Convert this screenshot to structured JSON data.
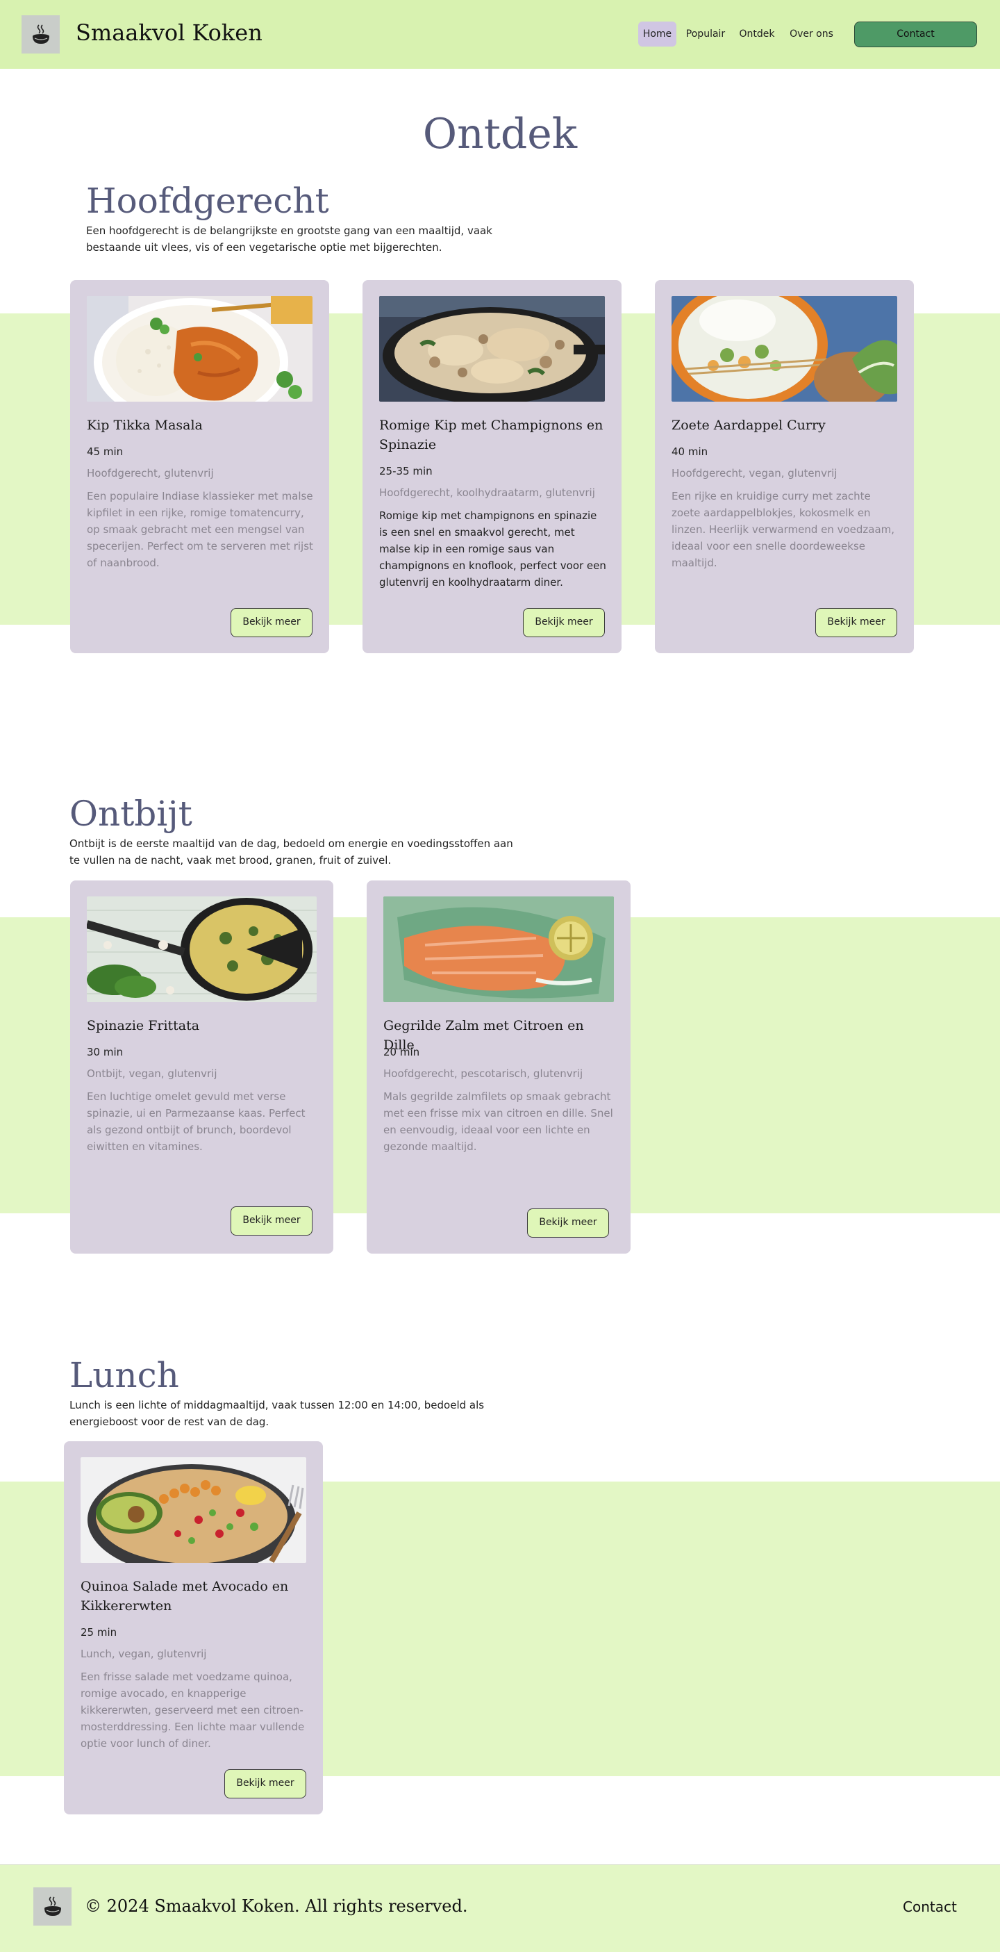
{
  "header": {
    "brand": "Smaakvol Koken",
    "nav": [
      "Home",
      "Populair",
      "Ontdek",
      "Over ons"
    ],
    "contact_label": "Contact",
    "logo_icon": "cooking-pot-icon"
  },
  "page_title": "Ontdek",
  "sections": [
    {
      "title": "Hoofdgerecht",
      "desc": "Een hoofdgerecht is de belangrijkste en grootste gang van een maaltijd, vaak bestaande uit vlees, vis of een vegetarische optie met bijgerechten.",
      "cards": [
        {
          "title": "Kip Tikka Masala",
          "time": "45 min",
          "tags": "Hoofdgerecht, glutenvrij",
          "desc": "Een populaire Indiase klassieker met malse kipfilet in een rijke, romige tomatencurry, op smaak gebracht met een mengsel van specerijen. Perfect om te serveren met rijst of naanbrood.",
          "button": "Bekijk meer"
        },
        {
          "title": "Romige Kip met Champignons en Spinazie",
          "time": "25-35 min",
          "tags": "Hoofdgerecht, koolhydraatarm, glutenvrij",
          "desc": "Romige kip met champignons en spinazie is een snel en smaakvol gerecht, met malse kip in een romige saus van champignons en knoflook, perfect voor een glutenvrij en koolhydraatarm diner.",
          "button": "Bekijk meer"
        },
        {
          "title": "Zoete Aardappel Curry",
          "time": "40 min",
          "tags": "Hoofdgerecht, vegan, glutenvrij",
          "desc": "Een rijke en kruidige curry met zachte zoete aardappelblokjes, kokosmelk en linzen. Heerlijk verwarmend en voedzaam, ideaal voor een snelle doordeweekse maaltijd.",
          "button": "Bekijk meer"
        }
      ]
    },
    {
      "title": "Ontbijt",
      "desc": "Ontbijt is de eerste maaltijd van de dag, bedoeld om energie en voedingsstoffen aan te vullen na de nacht, vaak met brood, granen, fruit of zuivel.",
      "cards": [
        {
          "title": "Spinazie Frittata",
          "time": "30 min",
          "tags": "Ontbijt, vegan, glutenvrij",
          "desc": "Een luchtige omelet gevuld met verse spinazie, ui en Parmezaanse kaas. Perfect als gezond ontbijt of brunch, boordevol eiwitten en vitamines.",
          "button": "Bekijk meer"
        },
        {
          "title": "Gegrilde Zalm met Citroen en Dille",
          "time": "20 min",
          "tags": "Hoofdgerecht, pescotarisch, glutenvrij",
          "desc": "Mals gegrilde zalmfilets op smaak gebracht met een frisse mix van citroen en dille. Snel en eenvoudig, ideaal voor een lichte en gezonde maaltijd.",
          "button": "Bekijk meer"
        }
      ]
    },
    {
      "title": "Lunch",
      "desc": "Lunch is een lichte of middagmaaltijd, vaak tussen 12:00 en 14:00, bedoeld als energieboost voor de rest van de dag.",
      "cards": [
        {
          "title": "Quinoa Salade met Avocado en Kikkererwten",
          "time": "25 min",
          "tags": "Lunch, vegan, glutenvrij",
          "desc": "Een frisse salade met voedzame quinoa, romige avocado, en knapperige kikkererwten, geserveerd met een citroen-mosterddressing. Een lichte maar vullende optie voor lunch of diner.",
          "button": "Bekijk meer"
        }
      ]
    }
  ],
  "footer": {
    "copyright": "© 2024 Smaakvol Koken. All rights reserved.",
    "contact": "Contact"
  },
  "colors": {
    "header_bg": "#d8f2b0",
    "band_bg": "#e3f7c5",
    "card_bg": "#d8d1df",
    "heading": "#565a7a",
    "contact_button": "#4e9a66",
    "active_nav": "#d0c6e3"
  }
}
